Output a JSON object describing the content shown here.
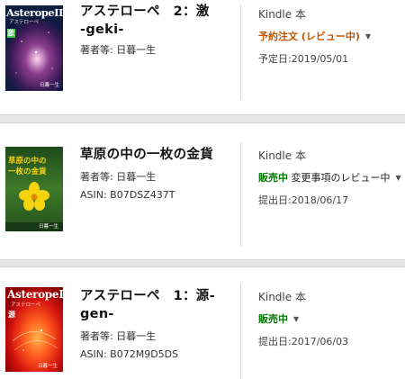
{
  "books": [
    {
      "title_lines": [
        "アステローペ　2：激",
        "-geki-"
      ],
      "author_label": "著者等:",
      "author": "日暮一生",
      "asin": "",
      "format": "Kindle 本",
      "status": "予約注文 (レビュー中)",
      "status_extra": "",
      "date_label": "予定日:",
      "date": "2019/05/01",
      "cover": {
        "title": "AsteropeII",
        "subtitle": "アステローペ",
        "kanji": "激",
        "author": "日暮一生",
        "colors": [
          "#0d1b3e",
          "#3a1a55",
          "#8c3d8f"
        ]
      }
    },
    {
      "title_lines": [
        "草原の中の一枚の金貨"
      ],
      "author_label": "著者等:",
      "author": "日暮一生",
      "asin": "ASIN: B07DSZ437T",
      "format": "Kindle 本",
      "status": "販売中",
      "status_extra": "変更事項のレビュー中",
      "date_label": "提出日:",
      "date": "2018/06/17",
      "cover": {
        "title_a": "草原の中の",
        "title_b": "一枚の金貨",
        "author": "日暮一生",
        "colors": [
          "#1e4a1a",
          "#3f7a2a",
          "#f5d30f"
        ]
      }
    },
    {
      "title_lines": [
        "アステローペ　1：源-gen-"
      ],
      "author_label": "著者等:",
      "author": "日暮一生",
      "asin": "ASIN: B072M9D5DS",
      "format": "Kindle 本",
      "status": "販売中",
      "status_extra": "",
      "date_label": "提出日:",
      "date": "2017/06/03",
      "cover": {
        "title": "AsteropeI",
        "subtitle": "アステローペ",
        "kanji": "源",
        "author": "日暮一生",
        "colors": [
          "#8b0000",
          "#d4140f",
          "#ff5a1e"
        ]
      }
    }
  ],
  "colors": {
    "preorder": "#c45500",
    "on_sale": "#007600",
    "separator": "#e6e6e6",
    "divider": "#d4d4d4"
  },
  "icons": [
    "dropdown-caret-icon"
  ]
}
